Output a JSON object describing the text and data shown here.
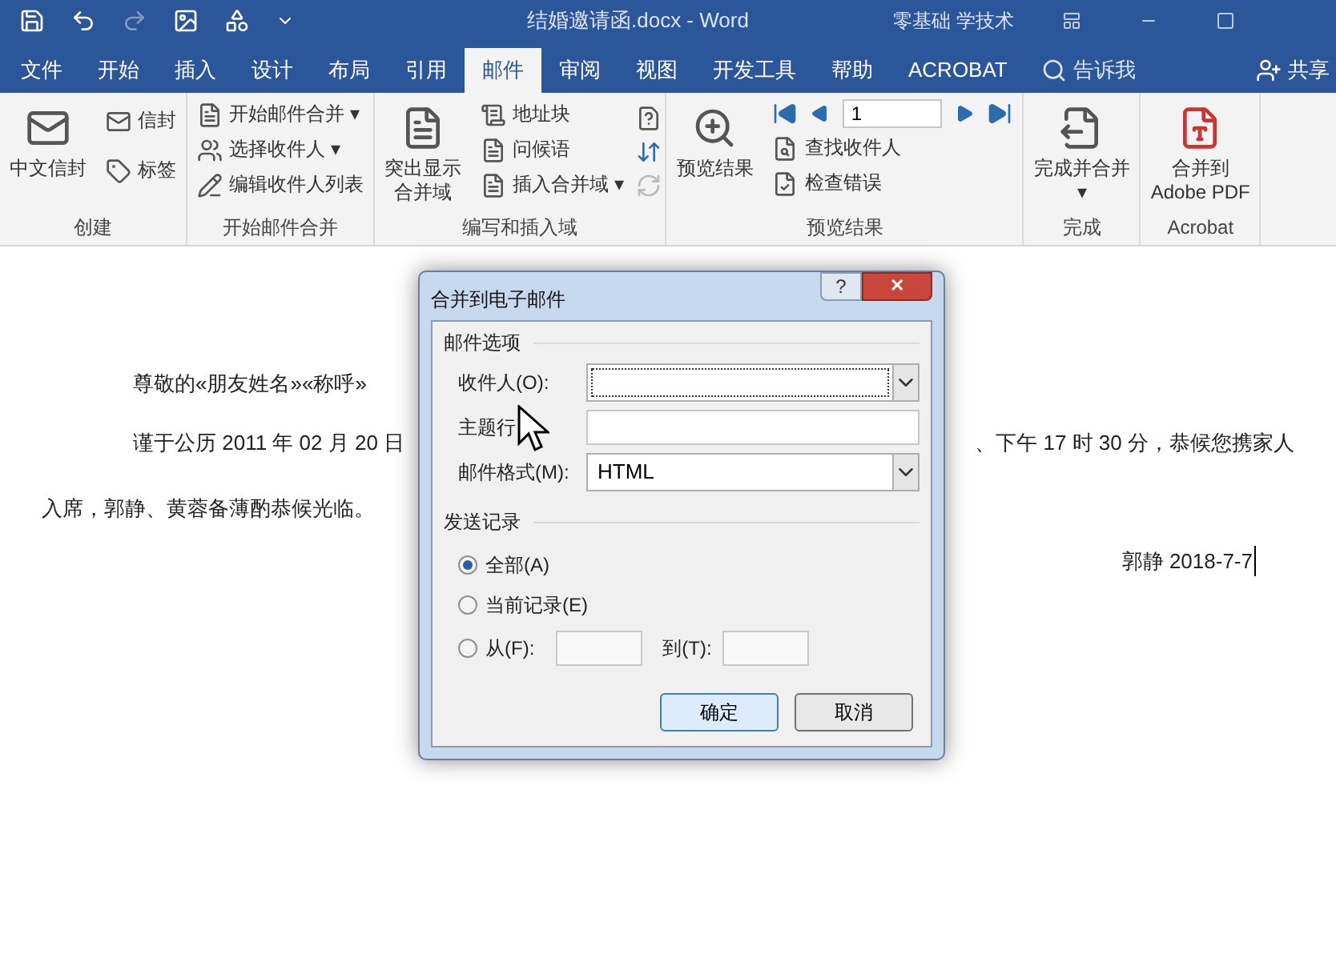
{
  "title_bar": {
    "document_title": "结婚邀请函.docx  -  Word",
    "user": "零基础 学技术"
  },
  "tabs": [
    {
      "label": "文件",
      "selected": false
    },
    {
      "label": "开始",
      "selected": false
    },
    {
      "label": "插入",
      "selected": false
    },
    {
      "label": "设计",
      "selected": false
    },
    {
      "label": "布局",
      "selected": false
    },
    {
      "label": "引用",
      "selected": false
    },
    {
      "label": "邮件",
      "selected": true
    },
    {
      "label": "审阅",
      "selected": false
    },
    {
      "label": "视图",
      "selected": false
    },
    {
      "label": "开发工具",
      "selected": false
    },
    {
      "label": "帮助",
      "selected": false
    },
    {
      "label": "ACROBAT",
      "selected": false
    }
  ],
  "tell_me": "告诉我",
  "share": "共享",
  "ribbon": [
    {
      "label": "创建",
      "items": [
        {
          "kind": "large",
          "label": "中文信封"
        },
        {
          "kind": "small",
          "labels": [
            "信封",
            "标签"
          ]
        }
      ]
    },
    {
      "label": "开始邮件合并",
      "items": [
        {
          "kind": "small",
          "labels": [
            "开始邮件合并 ▾",
            "选择收件人 ▾",
            "编辑收件人列表"
          ]
        }
      ]
    },
    {
      "label": "编写和插入域",
      "items": [
        {
          "kind": "large",
          "label": "突出显示合并域"
        },
        {
          "kind": "small",
          "labels": [
            "地址块",
            "问候语",
            "插入合并域  ▾"
          ]
        },
        {
          "kind": "icons"
        }
      ]
    },
    {
      "label": "预览结果",
      "items": [
        {
          "kind": "large",
          "label": "预览结果"
        },
        {
          "kind": "nav",
          "record": "1",
          "labels": [
            "查找收件人",
            "检查错误"
          ]
        }
      ]
    },
    {
      "label": "完成",
      "items": [
        {
          "kind": "large",
          "label": "完成并合并\n▾"
        }
      ]
    },
    {
      "label": "Acrobat",
      "items": [
        {
          "kind": "large",
          "label": "合并到\nAdobe PDF"
        }
      ]
    }
  ],
  "document": {
    "salutation": "尊敬的«朋友姓名»«称呼»",
    "line_left": "谨于公历 2011 年 02 月 20 日",
    "line_right": "、下午 17 时 30 分，恭候您携家人",
    "line_3": "入席，郭静、黄蓉备薄酌恭候光临。",
    "signature": "郭静  2018-7-7"
  },
  "dialog": {
    "title": "合并到电子邮件",
    "help": "?",
    "close": "✕",
    "mail_options": {
      "label": "邮件选项",
      "fields": [
        {
          "kind": "dropdown",
          "label": "收件人(O):"
        },
        {
          "kind": "text",
          "label": "主题行"
        },
        {
          "kind": "dropdown",
          "label": "邮件格式(M):",
          "value": "HTML"
        }
      ]
    },
    "send_records": {
      "label": "发送记录",
      "options": [
        {
          "label": "全部(A)",
          "selected": true
        },
        {
          "label": "当前记录(E)",
          "selected": false
        },
        {
          "label": "从(F):",
          "selected": false,
          "to_label": "到(T):"
        }
      ]
    },
    "buttons": [
      {
        "label": "确定",
        "default": true
      },
      {
        "label": "取消",
        "default": false
      }
    ]
  }
}
